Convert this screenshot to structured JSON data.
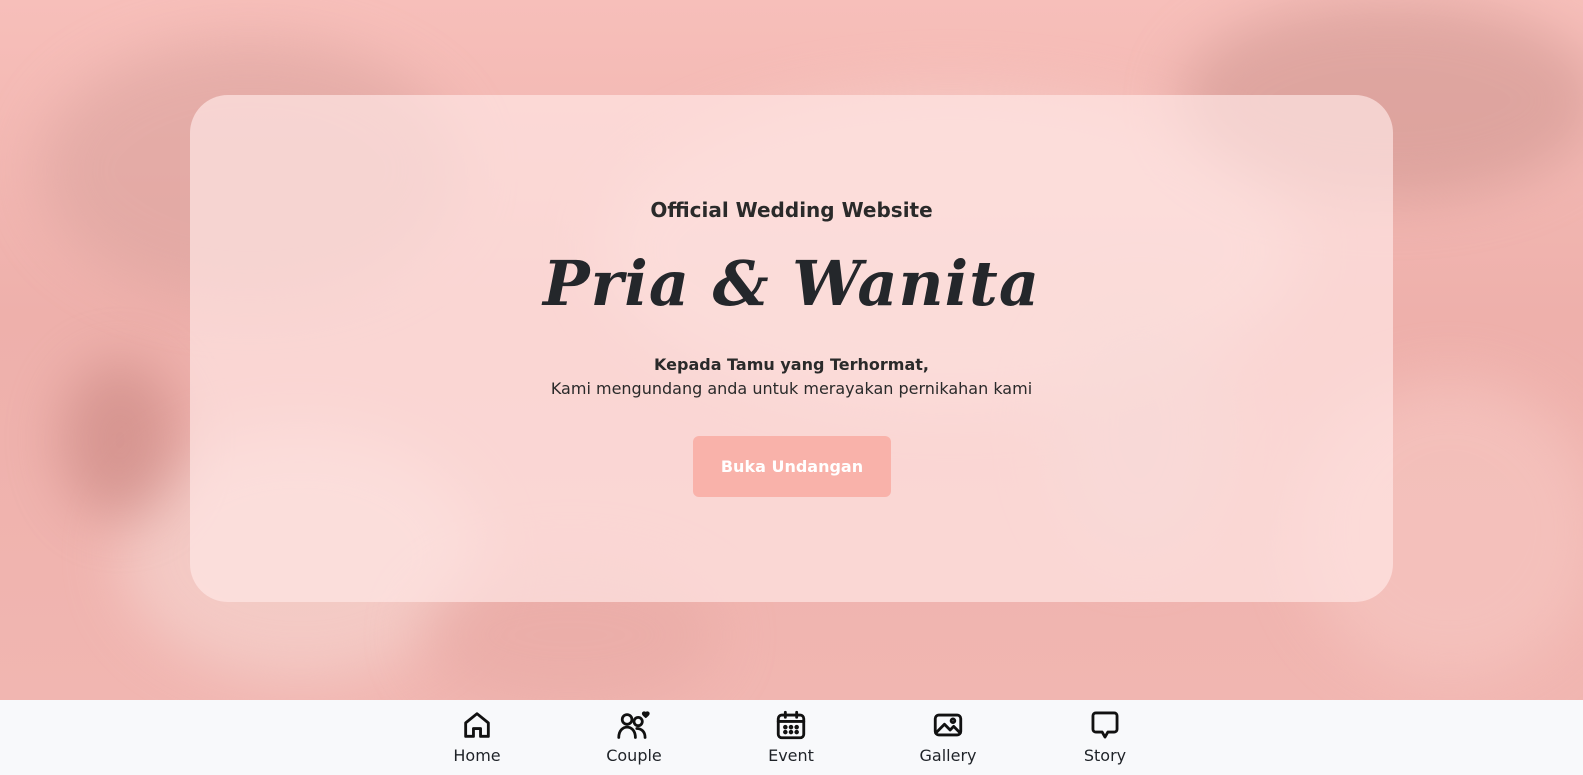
{
  "hero": {
    "subtitle": "Official Wedding Website",
    "couple_names": "Pria & Wanita",
    "greeting": "Kepada Tamu yang Terhormat,",
    "invitation_text": "Kami mengundang anda untuk merayakan pernikahan kami",
    "open_button_label": "Buka Undangan"
  },
  "bottom_nav": {
    "items": [
      {
        "label": "Home",
        "icon": "home-icon"
      },
      {
        "label": "Couple",
        "icon": "couple-icon"
      },
      {
        "label": "Event",
        "icon": "calendar-icon"
      },
      {
        "label": "Gallery",
        "icon": "image-icon"
      },
      {
        "label": "Story",
        "icon": "chat-bubble-icon"
      }
    ]
  },
  "colors": {
    "accent": "#f9b2aa",
    "hero_tint": "#f4b9b4",
    "text_dark": "#24272b",
    "nav_background": "#f8f9fb"
  }
}
